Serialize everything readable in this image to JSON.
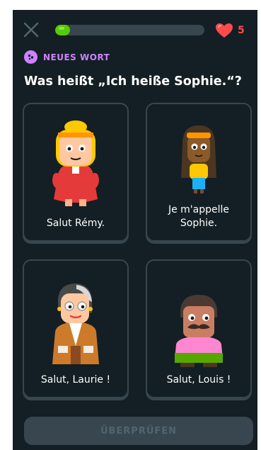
{
  "header": {
    "close_icon": "close-icon",
    "progress_fraction": 0.1,
    "hearts_count": "5",
    "heart_color": "#ff4b4b"
  },
  "badge": {
    "label": "NEUES WORT",
    "color": "#ce82ff"
  },
  "question": {
    "title": "Was heißt „Ich heiße Sophie.“?"
  },
  "options": [
    {
      "label": "Salut Rémy."
    },
    {
      "label": "Je m'appelle\nSophie."
    },
    {
      "label": "Salut, Laurie !"
    },
    {
      "label": "Salut, Louis !"
    }
  ],
  "footer": {
    "check_label": "ÜBERPRÜFEN"
  },
  "colors": {
    "background": "#131f24",
    "border": "#37464f",
    "progress": "#58cc02"
  }
}
